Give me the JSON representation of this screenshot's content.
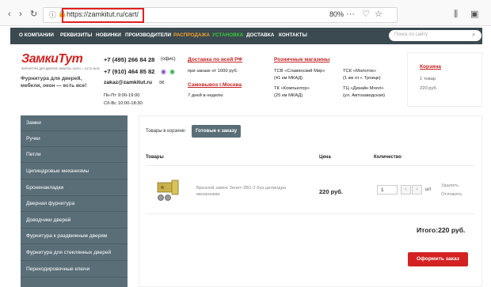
{
  "browser": {
    "url": "https://zamkitut.ru/cart/",
    "zoom": "80%"
  },
  "topnav": {
    "items": [
      "О КОМПАНИИ",
      "РЕКВИЗИТЫ",
      "НОВИНКИ",
      "ПРОИЗВОДИТЕЛИ",
      "РАСПРОДАЖА",
      "УСТАНОВКА",
      "ДОСТАВКА",
      "КОНТАКТЫ"
    ],
    "search_placeholder": "Поиск по сайту"
  },
  "header": {
    "logo": "ЗамкиТут",
    "logo_sub": "ФУРНИТУРА ДЛЯ ДВЕРЕЙ, МЕБЕЛИ, ОКОН — ЕСТЬ ВСЕ!",
    "tagline": "Фурнитура для дверей, мебели, окон — есть все!",
    "phone1": "+7 (495) 266 84 28",
    "phone1_note": "(офис)",
    "phone2": "+7 (910) 464 85 82",
    "email": "zakaz@zamkitut.ru",
    "hours1": "Пн-Пт 9:00-19:00",
    "hours2": "Сб-Вс 10:00-18:30",
    "delivery_link": "Доставка по всей РФ",
    "delivery_text": "при заказе от 1000 руб.",
    "pickup_link": "Самовывоз г.Москва",
    "pickup_text": "7 дней в неделю",
    "stores_link": "Розничные магазины",
    "stores": [
      {
        "name": "ТСВ «Славянский Мир»",
        "loc": "(41 км МКАД)"
      },
      {
        "name": "ТСК «Молоток»",
        "loc": "(1 км от г. Троицк)"
      },
      {
        "name": "ТК «Компьютор»",
        "loc": "(25 км МКАД)"
      },
      {
        "name": "ТЦ «Дизайн Молл»",
        "loc": "(ул. Автозаводская)"
      }
    ],
    "cart_link": "Корзина",
    "cart_count": "1 товар",
    "cart_sum": "220 руб."
  },
  "sidebar": {
    "items": [
      "Замки",
      "Ручки",
      "Петли",
      "Цилиндровые механизмы",
      "Броненакладки",
      "Дверная фурнитура",
      "Доводчики дверей",
      "Фурнитура к раздвижным дверям",
      "Фурнитура для стеклянных дверей",
      "Переходировочные ключи"
    ]
  },
  "cart": {
    "in_cart_label": "Товары в корзине:",
    "ready_button": "Готовые к заказу",
    "headers": {
      "product": "Товары",
      "price": "Цена",
      "qty": "Количество"
    },
    "item": {
      "name": "Врезной замок Зенит-3В1-2 без цилиндра механизма",
      "price": "220 руб.",
      "qty": "1",
      "unit": "шт",
      "delete": "Удалить",
      "postpone": "Отложить"
    },
    "total": "Итого:220 руб.",
    "order_button": "Оформить заказ"
  }
}
